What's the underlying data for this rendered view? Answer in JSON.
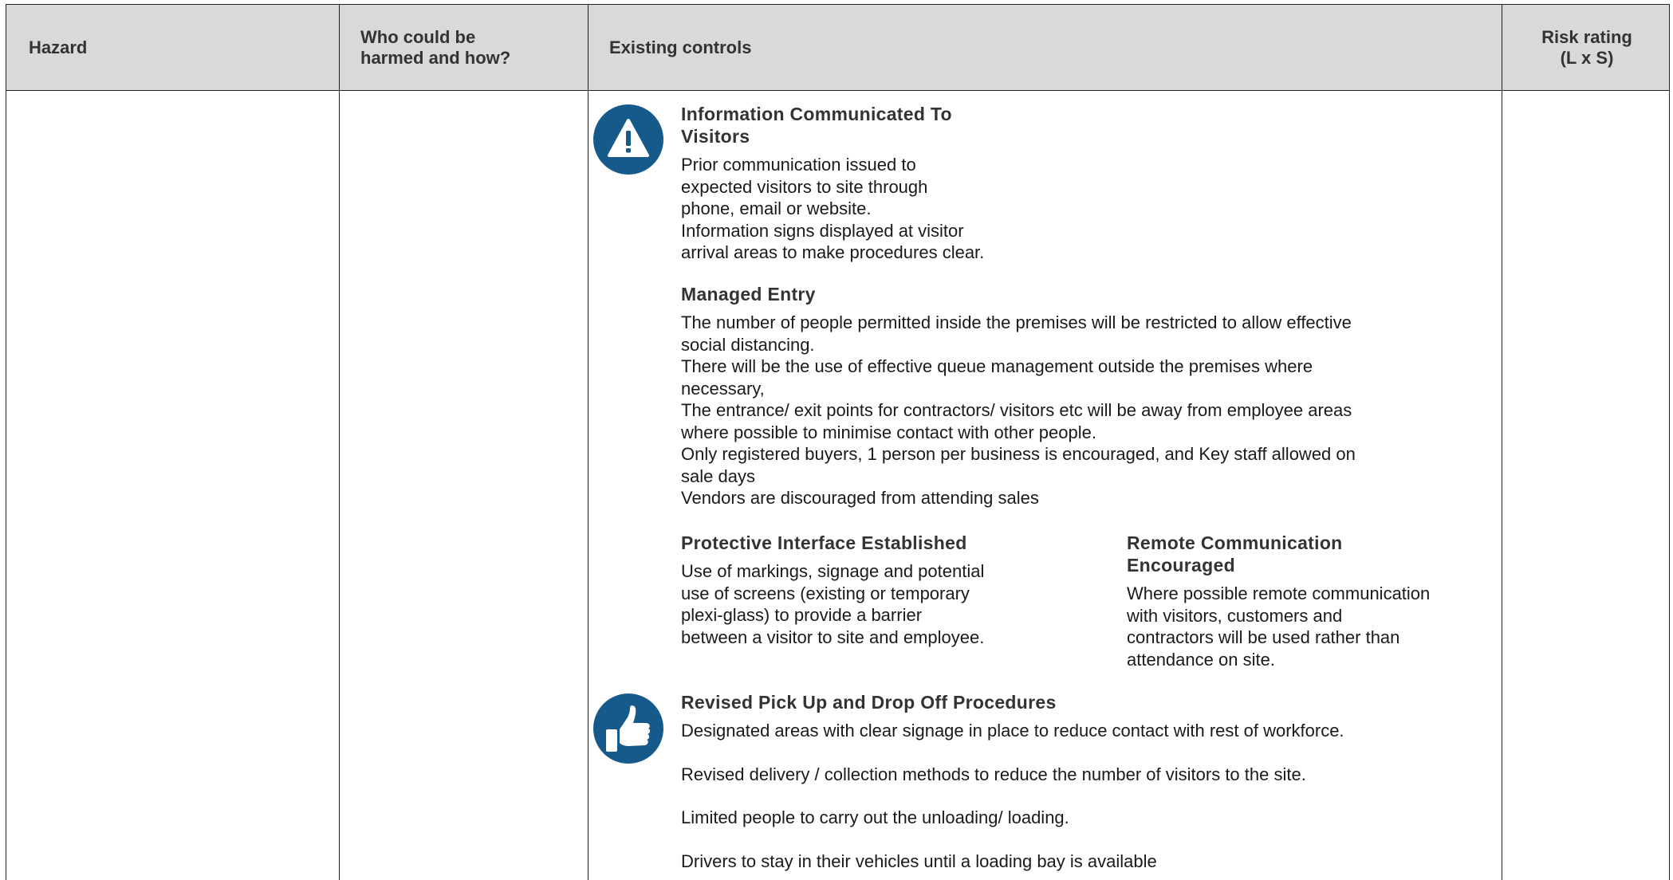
{
  "table": {
    "headers": {
      "hazard": "Hazard",
      "who_line1": "Who could be",
      "who_line2": "harmed and how?",
      "controls": "Existing controls",
      "risk_line1": "Risk rating",
      "risk_line2": "(L x S)"
    }
  },
  "icons": {
    "warning": "warning-icon",
    "thumbs_up": "thumbs-up-icon",
    "brand_color": "#155a8a"
  },
  "controls": {
    "info": {
      "title_line1": "Information Communicated To",
      "title_line2": "Visitors",
      "lines": [
        "Prior communication issued to",
        "expected visitors to site through",
        "phone, email or website.",
        "Information signs displayed at visitor",
        "arrival areas to make procedures clear."
      ]
    },
    "managed": {
      "title": "Managed Entry",
      "lines": [
        "The number of people permitted inside the premises will be restricted to allow effective",
        "social distancing.",
        "There will be the use of effective queue management outside the premises where",
        "necessary,",
        "The entrance/ exit points for contractors/ visitors etc will be away from employee areas",
        "where possible to minimise contact with other people.",
        "Only registered buyers, 1 person per business is encouraged, and Key staff allowed on",
        "sale days",
        "Vendors are discouraged from attending sales"
      ]
    },
    "protective": {
      "title": "Protective Interface Established",
      "lines": [
        "Use of markings, signage and potential",
        "use of screens (existing or temporary",
        "plexi-glass) to provide a barrier",
        "between a visitor to site and employee."
      ]
    },
    "remote": {
      "title_line1": "Remote Communication",
      "title_line2": "Encouraged",
      "lines": [
        "Where possible remote communication",
        "with visitors, customers and",
        "contractors will be used rather than",
        "attendance on site."
      ]
    },
    "revised": {
      "title": "Revised Pick Up and Drop Off Procedures",
      "lines": [
        "Designated areas with clear signage in place to reduce contact with rest of workforce.",
        "Revised delivery / collection methods to reduce the number of visitors to the site.",
        "Limited people to carry out the unloading/ loading.",
        "Drivers to stay in their vehicles until a loading bay is available"
      ]
    }
  }
}
